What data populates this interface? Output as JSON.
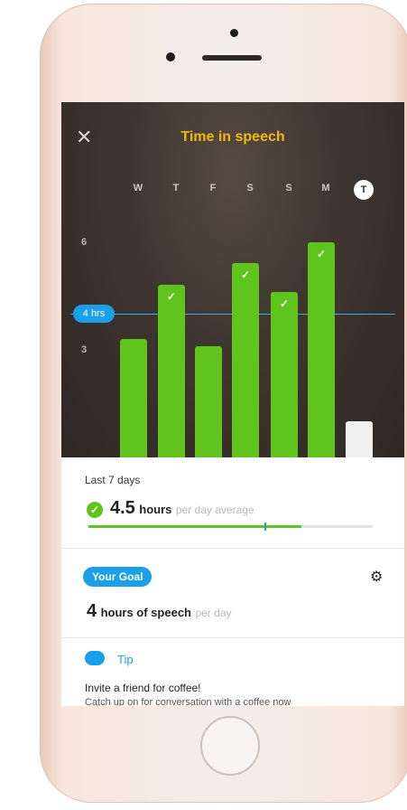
{
  "header": {
    "close_icon": "close-icon",
    "title": "Time in speech"
  },
  "week": {
    "days": [
      "W",
      "T",
      "F",
      "S",
      "S",
      "M",
      "T"
    ],
    "today_index": 6
  },
  "chart_data": {
    "type": "bar",
    "categories": [
      "W",
      "T",
      "F",
      "S",
      "S",
      "M",
      "T"
    ],
    "values": [
      3.3,
      4.8,
      3.1,
      5.4,
      4.6,
      6.0,
      1.0
    ],
    "goal_met": [
      false,
      true,
      false,
      true,
      true,
      true,
      false
    ],
    "y_ticks": [
      "3",
      "6"
    ],
    "goal_value": 4,
    "goal_label": "4 hrs",
    "ylim": [
      0,
      7.3
    ],
    "colors": {
      "bar": "#5fc41c",
      "today": "#f0f0f0",
      "goal_line": "#3aa7e6"
    }
  },
  "summary": {
    "period_label": "Last 7 days",
    "value": "4.5",
    "unit": "hours",
    "suffix": "per day average",
    "progress_fraction": 0.75,
    "goal_marker_fraction": 0.62
  },
  "goal": {
    "badge": "Your Goal",
    "value": "4",
    "unit": "hours of speech",
    "suffix": "per day",
    "settings_icon": "gear-icon"
  },
  "tip": {
    "label": "Tip",
    "text": "Invite a friend for coffee!",
    "subtext": "Catch up on for conversation with a coffee now"
  },
  "colors": {
    "accent": "#1aa0e8",
    "title": "#f2b90f",
    "success": "#5fc41c"
  }
}
